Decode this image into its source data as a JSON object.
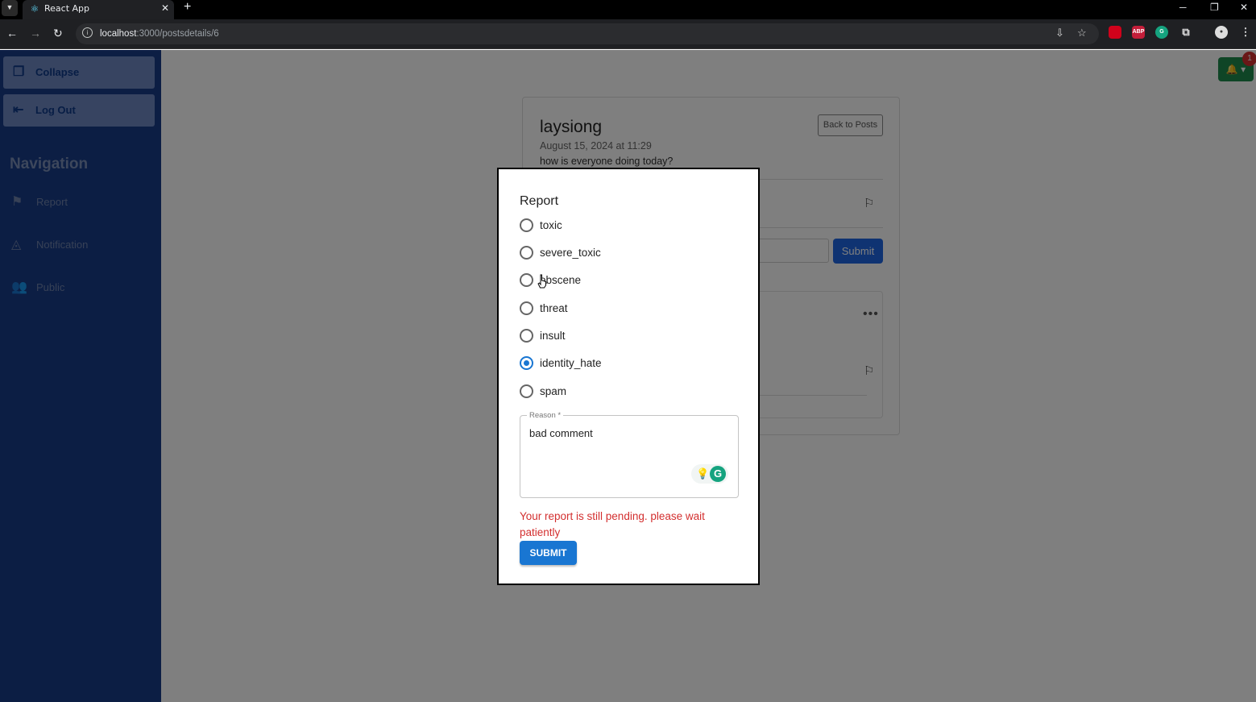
{
  "browser": {
    "tab_title": "React App",
    "tab_close": "✕",
    "new_tab": "+",
    "url_host": "localhost",
    "url_path": ":3000/postsdetails/6"
  },
  "sidebar": {
    "collapse_label": "Collapse",
    "logout_label": "Log Out",
    "nav_heading": "Navigation",
    "items": [
      {
        "label": "Report",
        "icon": "report-icon"
      },
      {
        "label": "Notification",
        "icon": "notification-icon"
      },
      {
        "label": "Public",
        "icon": "group-icon"
      }
    ]
  },
  "post": {
    "username": "laysiong",
    "date": "August 15, 2024 at 11:29",
    "body": "how is everyone doing today?",
    "back_label": "Back to Posts",
    "comment_submit_label": "Submit"
  },
  "notifications": {
    "count": "1"
  },
  "report_modal": {
    "title": "Report",
    "options": [
      {
        "label": "toxic",
        "selected": false
      },
      {
        "label": "severe_toxic",
        "selected": false
      },
      {
        "label": "obscene",
        "selected": false
      },
      {
        "label": "threat",
        "selected": false
      },
      {
        "label": "insult",
        "selected": false
      },
      {
        "label": "identity_hate",
        "selected": true
      },
      {
        "label": "spam",
        "selected": false
      }
    ],
    "reason_label": "Reason *",
    "reason_value": "bad comment",
    "pending_message": "Your report is still pending. please wait patiently",
    "submit_label": "SUBMIT"
  },
  "colors": {
    "sidebar_bg": "#193d88",
    "primary": "#1976d2",
    "error": "#d32f2f",
    "notification_bg": "#1f8a4c"
  }
}
